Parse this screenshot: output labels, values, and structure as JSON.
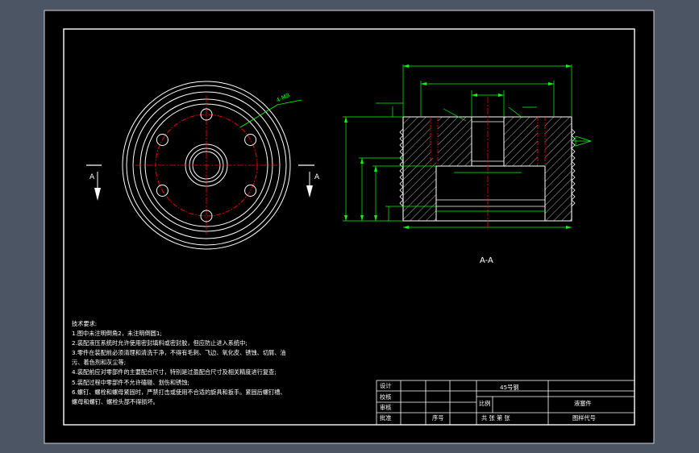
{
  "drawing": {
    "section_label": "A",
    "section_view_title": "A-A",
    "colors": {
      "background": "#4b5564",
      "sheet": "#000000",
      "frame": "#ffffff",
      "dimension": "#00ff00",
      "centerline": "#ff0000",
      "hatch": "#ffffff",
      "outline": "#ffffff"
    }
  },
  "notes": {
    "title": "技术要求:",
    "lines": [
      "1.图中未注明倒角2，未注明倒圆1;",
      "2.装配液压系统时允许使用密封填料或密封胶，但应防止进入系统中;",
      "3.零件在装配前必须清理和清洗干净，不得有毛刺、飞边、氧化皮、锈蚀、切屑、油",
      "污、着色剂和灰尘等;",
      "4.装配前应对零部件的主要配合尺寸，特别是过盈配合尺寸及相关精度进行复查;",
      "5.装配过程中零部件不允许磕碰、划伤和锈蚀;",
      "6.螺钉、螺栓和螺母紧固时，严禁打击或使用不合适的旋具和扳手。紧固后螺钉槽、",
      "螺母和螺钉、螺栓头部不得损坏。"
    ]
  },
  "title_block": {
    "design": "设计",
    "check": "校核",
    "review": "审核",
    "approve": "批准",
    "serial": "序号",
    "material": "45号钢",
    "scale": "比例",
    "part_name": "液塞件",
    "sheets": "共   张 第   张",
    "drawing_no": "图样代号"
  }
}
